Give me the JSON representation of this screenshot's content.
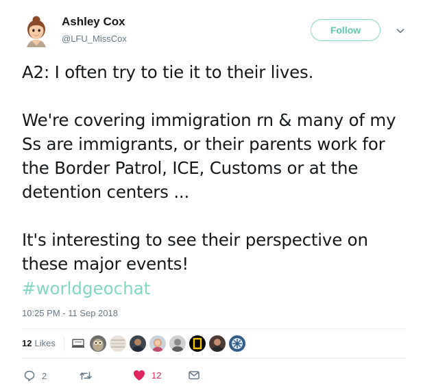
{
  "user": {
    "name": "Ashley Cox",
    "handle": "@LFU_MissCox"
  },
  "header": {
    "follow_label": "Follow"
  },
  "tweet": {
    "paragraphs": [
      "A2: I often try to tie it to their lives.",
      "We're covering immigration rn & many of my Ss are immigrants, or their parents work for the Border Patrol, ICE, Customs or at the detention centers ...",
      "It's interesting to see their perspective on these major events!"
    ],
    "hashtag": "#worldgeochat",
    "timestamp": "10:25 PM - 11 Sep 2018"
  },
  "engagement": {
    "likes_count": "12",
    "likes_label": "Likes",
    "likers": [
      "liker-avatar-1",
      "liker-avatar-2",
      "liker-avatar-3",
      "liker-avatar-4",
      "liker-avatar-5",
      "liker-avatar-6",
      "liker-avatar-7",
      "liker-avatar-8",
      "liker-avatar-9"
    ]
  },
  "actions": {
    "reply_count": "2",
    "retweet_count": "",
    "like_count": "12",
    "icons": [
      "reply-icon",
      "retweet-icon",
      "heart-icon",
      "envelope-icon"
    ]
  },
  "colors": {
    "accent": "#7fd7c4",
    "follow_text": "#5ec8b3",
    "like_red": "#e0245e",
    "secondary_text": "#657786"
  }
}
